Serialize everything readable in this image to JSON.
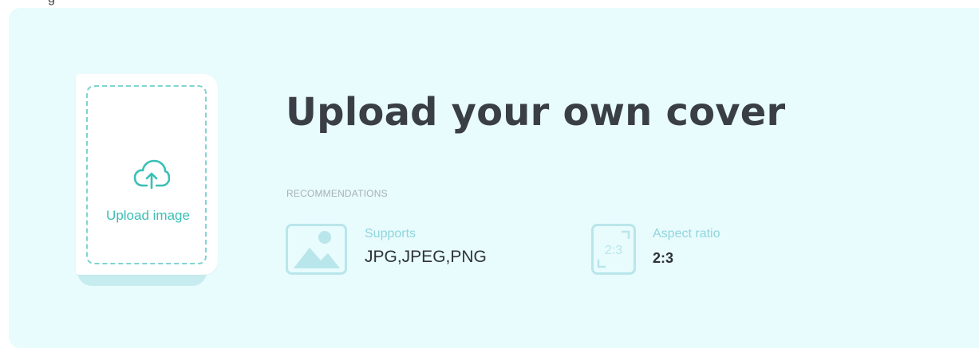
{
  "top_strip": {
    "text": "g"
  },
  "upload_tile": {
    "label": "Upload image",
    "icon": "cloud-upload-icon"
  },
  "main": {
    "title": "Upload your own cover",
    "recommendations_heading": "RECOMMENDATIONS",
    "supports": {
      "icon": "image-icon",
      "label": "Supports",
      "value": "JPG,JPEG,PNG"
    },
    "aspect_ratio": {
      "icon": "aspect-ratio-icon",
      "icon_text": "2:3",
      "label": "Aspect ratio",
      "value": "2:3"
    }
  },
  "colors": {
    "card_background": "#e8fbfd",
    "accent": "#3bbfb6",
    "accent_light": "#8fd6dc",
    "title": "#3a3f45"
  }
}
